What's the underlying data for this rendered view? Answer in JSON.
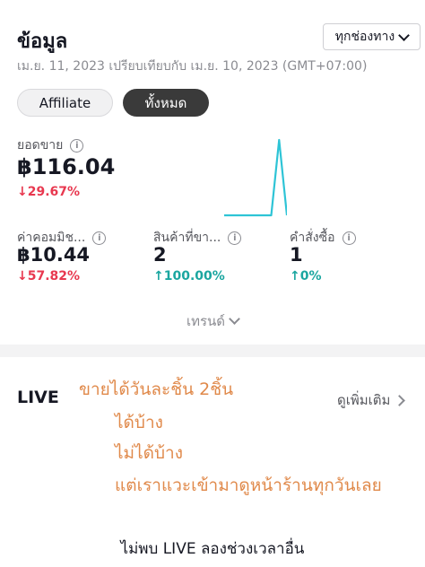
{
  "header": {
    "title": "ข้อมูล",
    "channel_select": "ทุกช่องทาง"
  },
  "date_range": "เม.ย. 11, 2023 เปรียบเทียบกับ เม.ย. 10, 2023 (GMT+07:00)",
  "filters": [
    "Affiliate",
    "ทั้งหมด"
  ],
  "active_filter": "ทั้งหมด",
  "metrics": {
    "sales": {
      "label": "ยอดขาย",
      "value": "฿116.04",
      "change": "29.67%",
      "direction": "down"
    },
    "commission": {
      "label": "ค่าคอมมิช...",
      "value": "฿10.44",
      "change": "57.82%",
      "direction": "down"
    },
    "products": {
      "label": "สินค้าที่ขา...",
      "value": "2",
      "change": "100.00%",
      "direction": "up"
    },
    "orders": {
      "label": "คำสั่งซื้อ",
      "value": "1",
      "change": "0%",
      "direction": "up"
    }
  },
  "sparkline": {
    "values": [
      0,
      0,
      0,
      0,
      0,
      0,
      0,
      1,
      0
    ],
    "color": "#2ec4d6"
  },
  "trend_label": "เทรนด์",
  "live": {
    "title": "LIVE",
    "see_more": "ดูเพิ่มเติม",
    "empty_text": "ไม่พบ LIVE ลองช่วงเวลาอื่น"
  },
  "handwritten_note": [
    "ขายได้วันละชิ้น 2ชิ้น",
    "ได้บ้าง",
    "ไม่ได้บ้าง",
    "แต่เราแวะเข้ามาดูหน้าร้านทุกวันเลย"
  ],
  "colors": {
    "down": "#e8384f",
    "up": "#1ba6a0",
    "note": "#e0894a",
    "pill_active": "#3a3a3a"
  }
}
